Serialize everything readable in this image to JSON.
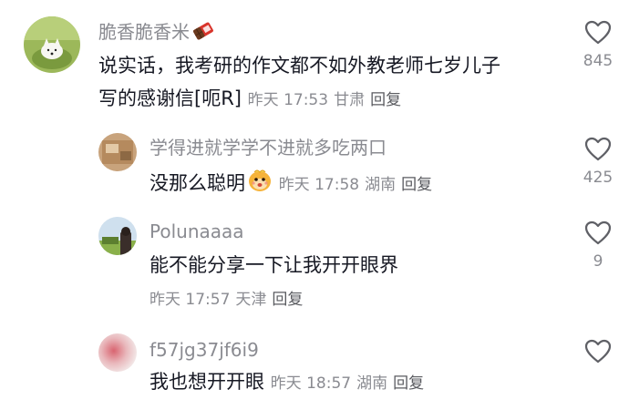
{
  "comments": [
    {
      "username": "脆香脆香米",
      "username_emoji": "chocolate-bar-icon",
      "text_line1": "说实话，我考研的作文都不如外教老师七岁儿子",
      "text_line2": "写的感谢信[呃R]",
      "time": "昨天 17:53",
      "location": "甘肃",
      "reply_label": "回复",
      "likes": "845"
    },
    {
      "username": "学得进就学学不进就多吃两口",
      "text": "没那么聪明",
      "text_emoji": "cute-face-emoji",
      "time": "昨天 17:58",
      "location": "湖南",
      "reply_label": "回复",
      "likes": "425"
    },
    {
      "username": "Polunaaaa",
      "text": "能不能分享一下让我开开眼界",
      "time": "昨天 17:57",
      "location": "天津",
      "reply_label": "回复",
      "likes": "9"
    },
    {
      "username": "f57jg37jf6i9",
      "text": "我也想开开眼",
      "time": "昨天 18:57",
      "location": "湖南",
      "reply_label": "回复",
      "likes": ""
    }
  ],
  "colors": {
    "text": "#161823",
    "meta": "#8a8b91",
    "icon": "#5f6066"
  }
}
